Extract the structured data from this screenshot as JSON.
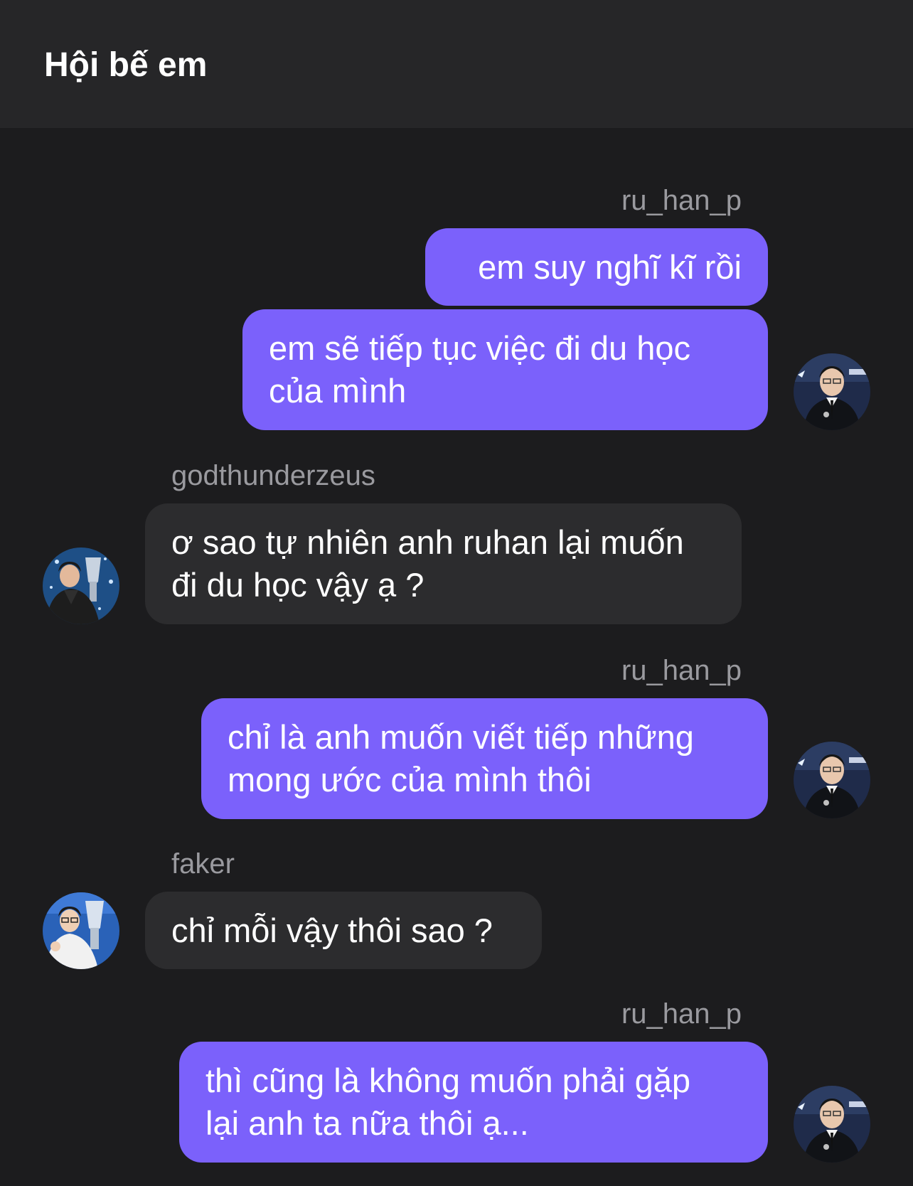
{
  "header": {
    "title": "Hội bế em"
  },
  "messages": [
    {
      "sender": "ru_han_p",
      "lines": [
        "em suy nghĩ kĩ rồi"
      ]
    },
    {
      "sender": "",
      "lines": [
        "em sẽ tiếp tục việc đi du học",
        "của mình"
      ]
    },
    {
      "sender": "godthunderzeus",
      "lines": [
        "ơ sao tự nhiên anh ruhan lại muốn",
        "đi du học vậy ạ ?"
      ]
    },
    {
      "sender": "ru_han_p",
      "lines": [
        "chỉ là anh muốn viết tiếp những",
        "mong ước của mình thôi"
      ]
    },
    {
      "sender": "faker",
      "lines": [
        "chỉ mỗi vậy thôi sao ?"
      ]
    },
    {
      "sender": "ru_han_p",
      "lines": [
        "thì cũng là không muốn phải gặp",
        "lại anh ta nữa thôi ạ..."
      ]
    }
  ],
  "colors": {
    "background": "#1c1c1e",
    "header": "#262628",
    "outgoing_bubble": "#7b61fb",
    "incoming_bubble": "#2c2c2e",
    "sender_name": "#9a9a9f"
  },
  "icons": {
    "self_avatar": "user-avatar-suit",
    "godthunderzeus_avatar": "user-avatar-trophy",
    "faker_avatar": "user-avatar-trophy"
  }
}
